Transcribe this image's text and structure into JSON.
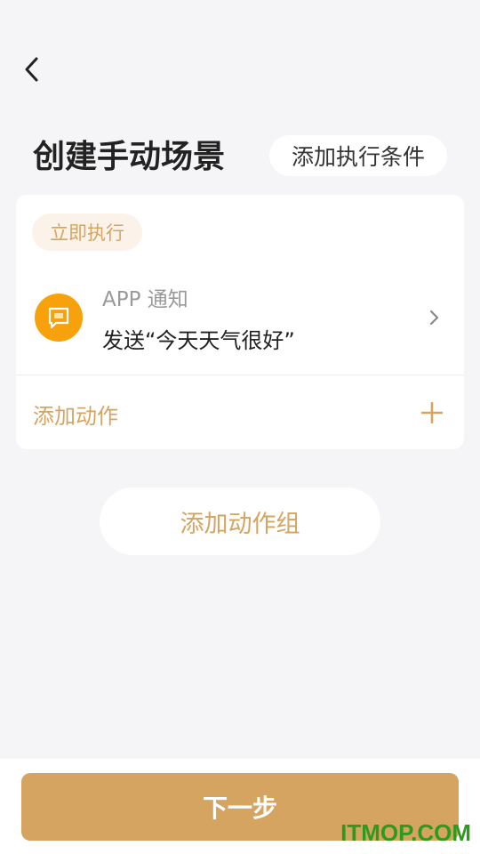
{
  "header": {
    "back_icon": "chevron-left-icon",
    "title": "创建手动场景",
    "add_condition_label": "添加执行条件"
  },
  "card": {
    "exec_tag": "立即执行",
    "action": {
      "icon": "message-icon",
      "type_label": "APP 通知",
      "description": "发送“今天天气很好”"
    },
    "add_action_label": "添加动作"
  },
  "add_group_label": "添加动作组",
  "footer": {
    "next_label": "下一步"
  },
  "watermark": "ITMOP.COM",
  "colors": {
    "accent": "#d6a461",
    "icon_bg": "#f7a10c",
    "background": "#f5f5f7",
    "tag_bg": "#fbf3ea",
    "watermark": "#2d9a1f"
  }
}
